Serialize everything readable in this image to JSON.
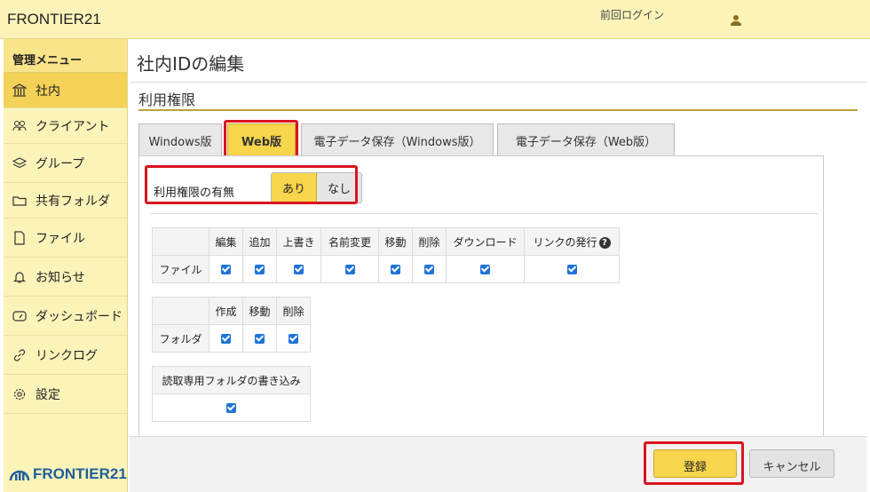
{
  "header": {
    "brand": "FRONTIER21",
    "last_login": "前回ログイン"
  },
  "sidebar": {
    "title": "管理メニュー",
    "items": [
      {
        "label": "社内",
        "icon": "building-icon"
      },
      {
        "label": "クライアント",
        "icon": "users-icon"
      },
      {
        "label": "グループ",
        "icon": "layers-icon"
      },
      {
        "label": "共有フォルダ",
        "icon": "folder-icon"
      },
      {
        "label": "ファイル",
        "icon": "file-icon"
      },
      {
        "label": "お知らせ",
        "icon": "bell-icon"
      },
      {
        "label": "ダッシュボード",
        "icon": "dashboard-icon"
      },
      {
        "label": "リンクログ",
        "icon": "link-icon"
      },
      {
        "label": "設定",
        "icon": "gear-icon"
      }
    ],
    "logo": "FRONTIER21"
  },
  "main": {
    "title": "社内IDの編集",
    "section": "利用権限",
    "tabs": [
      "Windows版",
      "Web版",
      "電子データ保存（Windows版）",
      "電子データ保存（Web版）"
    ],
    "active_tab": "Web版",
    "permission": {
      "label": "利用権限の有無",
      "on": "あり",
      "off": "なし",
      "selected": "あり"
    },
    "file_table": {
      "row_label": "ファイル",
      "columns": [
        "編集",
        "追加",
        "上書き",
        "名前変更",
        "移動",
        "削除",
        "ダウンロード",
        "リンクの発行"
      ],
      "help_mark": "?"
    },
    "folder_table": {
      "row_label": "フォルダ",
      "columns": [
        "作成",
        "移動",
        "削除"
      ]
    },
    "readonly_table": {
      "header": "読取専用フォルダの書き込み"
    }
  },
  "footer": {
    "save": "登録",
    "cancel": "キャンセル"
  },
  "colors": {
    "accent": "#f7d54c",
    "highlight": "#d9141f",
    "header_bg": "#fcf3b9",
    "checkbox": "#1f74d7"
  }
}
